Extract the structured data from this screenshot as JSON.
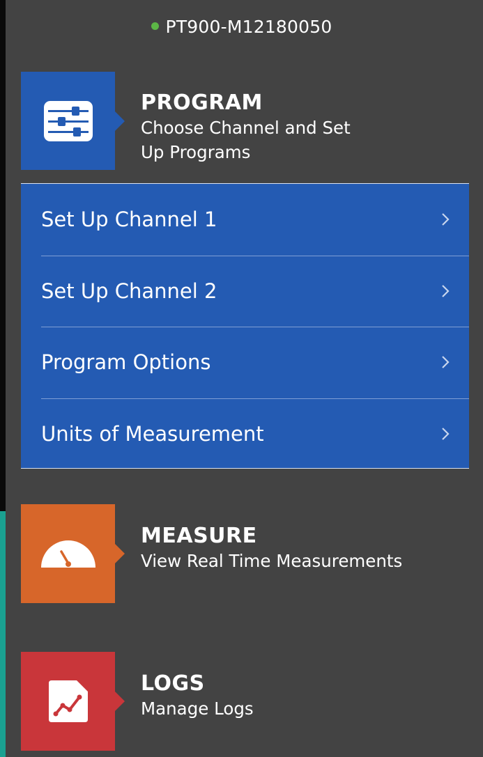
{
  "device": {
    "name": "PT900-M12180050",
    "status_color": "#5cb646"
  },
  "sections": {
    "program": {
      "title": "PROGRAM",
      "subtitle_line1": "Choose Channel and Set",
      "subtitle_line2": "Up Programs",
      "icon": "sliders-icon",
      "color": "#245bb3"
    },
    "measure": {
      "title": "MEASURE",
      "subtitle": "View Real Time Measurements",
      "icon": "gauge-icon",
      "color": "#d7662a"
    },
    "logs": {
      "title": "LOGS",
      "subtitle": "Manage Logs",
      "icon": "chart-document-icon",
      "color": "#c9363a"
    }
  },
  "program_menu": {
    "items": [
      {
        "label": "Set Up Channel 1",
        "icon": "chevron-right-icon"
      },
      {
        "label": "Set Up Channel 2",
        "icon": "chevron-right-icon"
      },
      {
        "label": "Program Options",
        "icon": "chevron-right-icon"
      },
      {
        "label": "Units of Measurement",
        "icon": "chevron-right-icon"
      }
    ]
  },
  "theme": {
    "background": "#434343",
    "accent_strip": "#1aa191"
  }
}
